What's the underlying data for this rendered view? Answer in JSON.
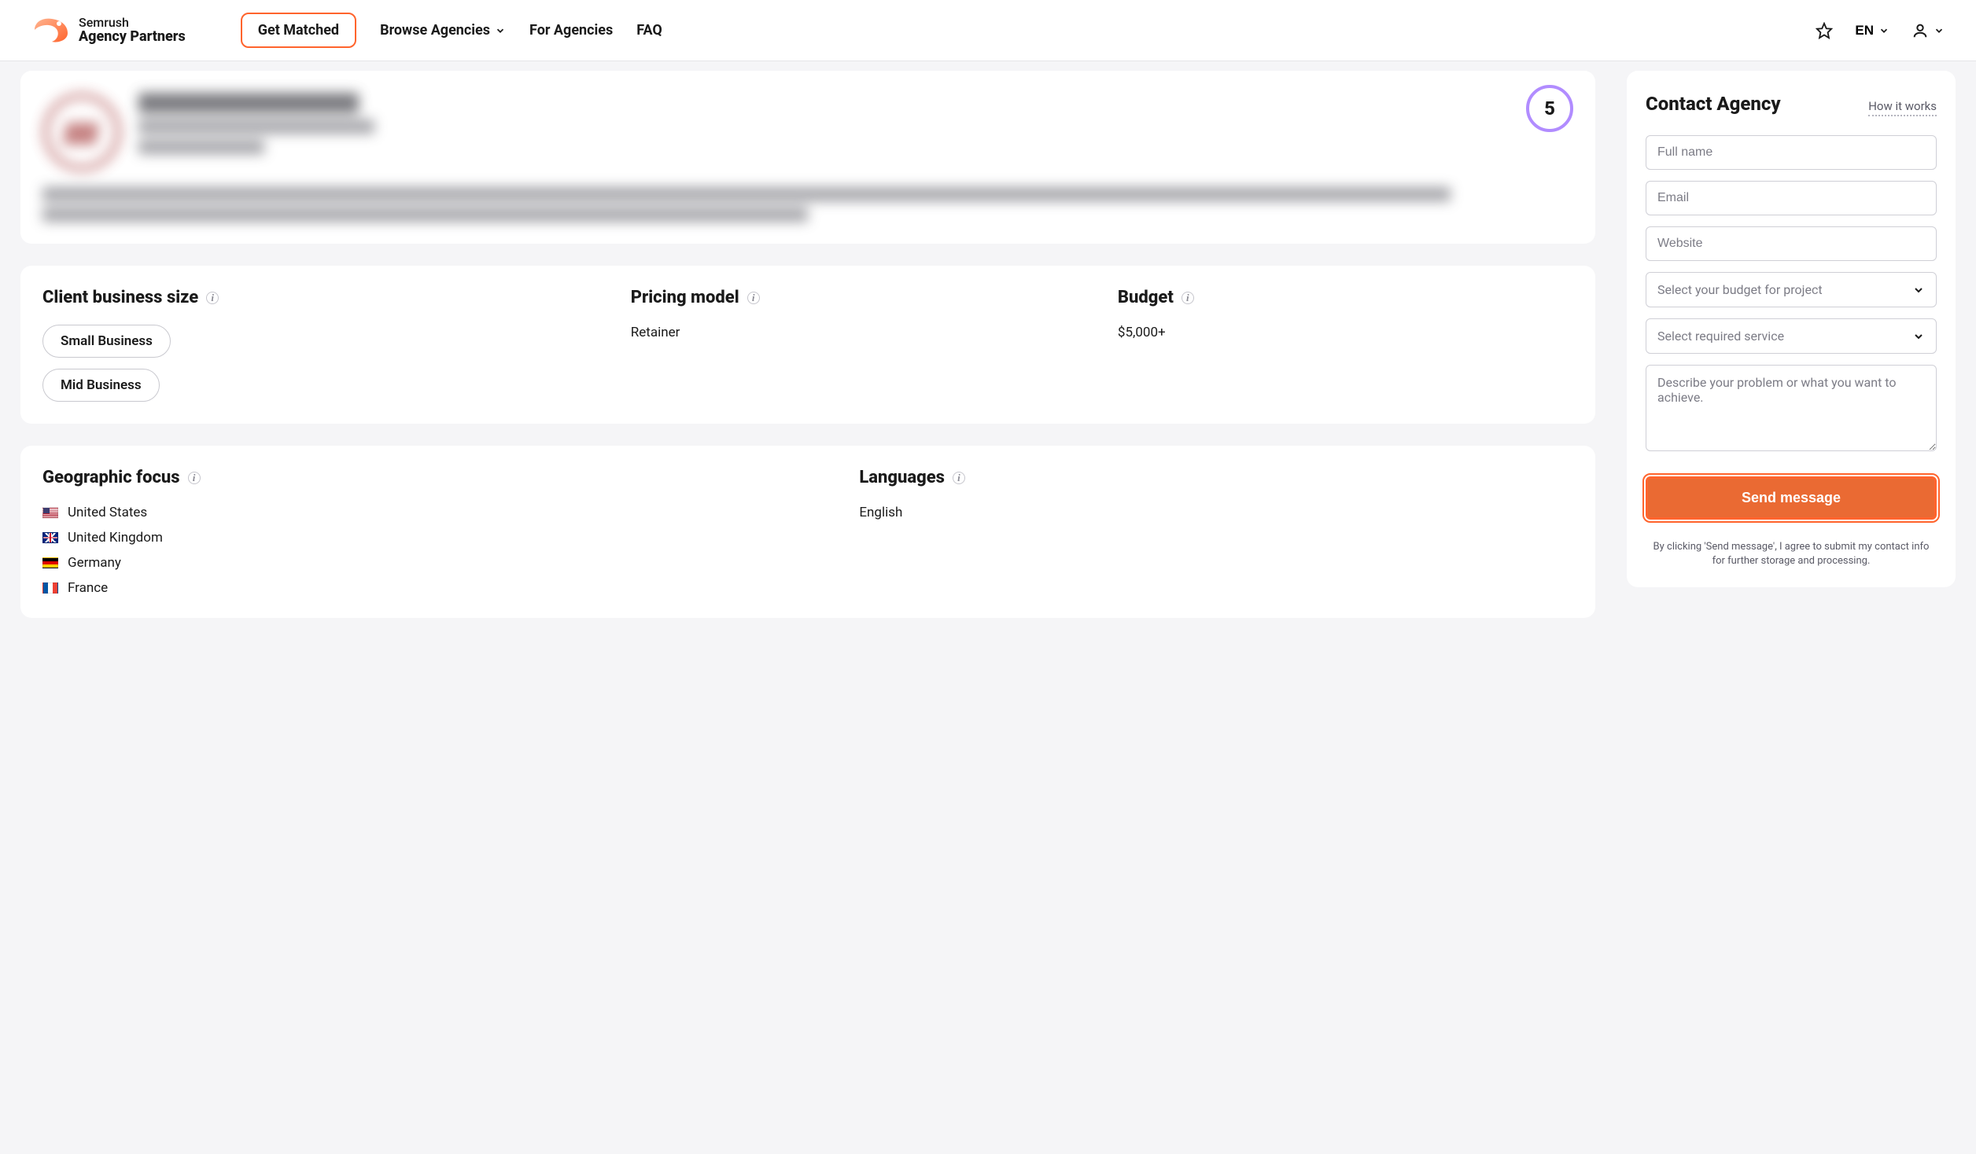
{
  "brand": {
    "line1": "Semrush",
    "line2": "Agency Partners"
  },
  "nav": {
    "get_matched": "Get Matched",
    "browse": "Browse Agencies",
    "for_agencies": "For Agencies",
    "faq": "FAQ"
  },
  "header": {
    "lang": "EN"
  },
  "profile": {
    "score": "5"
  },
  "details": {
    "client_size_heading": "Client business size",
    "pricing_heading": "Pricing model",
    "budget_heading": "Budget",
    "client_sizes": [
      "Small Business",
      "Mid Business"
    ],
    "pricing_value": "Retainer",
    "budget_value": "$5,000+"
  },
  "geo": {
    "heading": "Geographic focus",
    "lang_heading": "Languages",
    "countries": [
      "United States",
      "United Kingdom",
      "Germany",
      "France"
    ],
    "lang_value": "English"
  },
  "contact": {
    "title": "Contact Agency",
    "how": "How it works",
    "ph_name": "Full name",
    "ph_email": "Email",
    "ph_website": "Website",
    "select_budget": "Select your budget for project",
    "select_service": "Select required service",
    "ph_desc": "Describe your problem or what you want to achieve.",
    "send": "Send message",
    "legal": "By clicking 'Send message', I agree to submit my contact info for further storage and processing."
  }
}
